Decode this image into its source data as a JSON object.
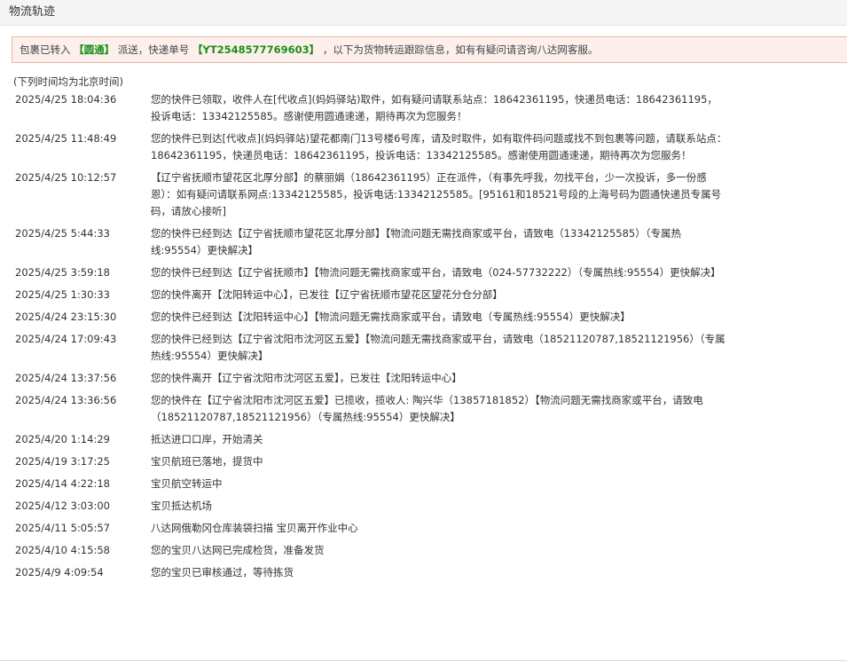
{
  "page": {
    "title": "物流轨迹"
  },
  "notice": {
    "prefix": "包裹已转入",
    "courier": "【圆通】",
    "middle": "派送，快递单号",
    "tracking_no": "【YT2548577769603】",
    "suffix": "，以下为货物转运跟踪信息，如有有疑问请咨询八达网客服。"
  },
  "timezone_note": "(下列时间均为北京时间)",
  "tracks": [
    {
      "time": "2025/4/25 18:04:36",
      "desc": "您的快件已领取，收件人在[代收点](妈妈驿站)取件，如有疑问请联系站点：18642361195，快递员电话：18642361195，投诉电话：13342125585。感谢使用圆通速递，期待再次为您服务！"
    },
    {
      "time": "2025/4/25 11:48:49",
      "desc": "您的快件已到达[代收点](妈妈驿站)望花都南门13号楼6号库，请及时取件，如有取件码问题或找不到包裹等问题，请联系站点：18642361195，快递员电话：18642361195，投诉电话：13342125585。感谢使用圆通速递，期待再次为您服务！"
    },
    {
      "time": "2025/4/25 10:12:57",
      "desc": "【辽宁省抚顺市望花区北厚分部】的蔡丽娟（18642361195）正在派件，（有事先呼我，勿找平台，少一次投诉，多一份感恩）：如有疑问请联系网点:13342125585，投诉电话:13342125585。[95161和18521号段的上海号码为圆通快递员专属号码，请放心接听]"
    },
    {
      "time": "2025/4/25 5:44:33",
      "desc": "您的快件已经到达【辽宁省抚顺市望花区北厚分部】【物流问题无需找商家或平台，请致电（13342125585）（专属热线:95554）更快解决】"
    },
    {
      "time": "2025/4/25 3:59:18",
      "desc": "您的快件已经到达【辽宁省抚顺市】【物流问题无需找商家或平台，请致电（024-57732222）（专属热线:95554）更快解决】"
    },
    {
      "time": "2025/4/25 1:30:33",
      "desc": "您的快件离开【沈阳转运中心】，已发往【辽宁省抚顺市望花区望花分仓分部】"
    },
    {
      "time": "2025/4/24 23:15:30",
      "desc": "您的快件已经到达【沈阳转运中心】【物流问题无需找商家或平台，请致电（专属热线:95554）更快解决】"
    },
    {
      "time": "2025/4/24 17:09:43",
      "desc": "您的快件已经到达【辽宁省沈阳市沈河区五爱】【物流问题无需找商家或平台，请致电（18521120787,18521121956）（专属热线:95554）更快解决】"
    },
    {
      "time": "2025/4/24 13:37:56",
      "desc": "您的快件离开【辽宁省沈阳市沈河区五爱】，已发往【沈阳转运中心】"
    },
    {
      "time": "2025/4/24 13:36:56",
      "desc": "您的快件在【辽宁省沈阳市沈河区五爱】已揽收，揽收人: 陶兴华（13857181852）【物流问题无需找商家或平台，请致电（18521120787,18521121956）（专属热线:95554）更快解决】"
    },
    {
      "time": "2025/4/20 1:14:29",
      "desc": "抵达进口口岸，开始清关"
    },
    {
      "time": "2025/4/19 3:17:25",
      "desc": "宝贝航班已落地，提货中"
    },
    {
      "time": "2025/4/14 4:22:18",
      "desc": "宝贝航空转运中"
    },
    {
      "time": "2025/4/12 3:03:00",
      "desc": "宝贝抵达机场"
    },
    {
      "time": "2025/4/11 5:05:57",
      "desc": "八达网俄勒冈仓库装袋扫描 宝贝离开作业中心"
    },
    {
      "time": "2025/4/10 4:15:58",
      "desc": "您的宝贝八达网已完成检货，准备发货"
    },
    {
      "time": "2025/4/9 4:09:54",
      "desc": "您的宝贝已审核通过，等待拣货"
    }
  ],
  "colors": {
    "highlight": "#1a8f1a",
    "notice_bg": "#fdf0ec",
    "notice_border": "#e9b7a9"
  }
}
